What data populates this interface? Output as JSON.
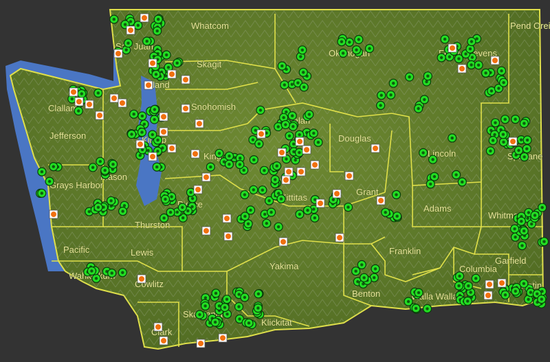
{
  "map": {
    "colors": {
      "background": "#333333",
      "water": "#4a76c4",
      "land": "#5f7d2a",
      "border": "#e0e04a",
      "marker_green": "#22dd22",
      "marker_orange": "#f07010"
    },
    "county_labels": [
      "Whatcom",
      "Okanogan",
      "Ferry",
      "Stevens",
      "Pend Oreille",
      "Clallam",
      "Skagit",
      "Snohomish",
      "San Juan",
      "Island",
      "Jefferson",
      "Chelan",
      "Douglas",
      "Lincoln",
      "Spokane",
      "Mason",
      "Kitsap",
      "King",
      "Grays Harbor",
      "Kittitas",
      "Grant",
      "Pierce",
      "Thurston",
      "Adams",
      "Whitman",
      "Pacific",
      "Lewis",
      "Franklin",
      "Garfield",
      "Wahkiakum",
      "Cowlitz",
      "Skamania",
      "Yakima",
      "Benton",
      "Walla Walla",
      "Asotin",
      "Clark",
      "Klickitat",
      "Columbia"
    ]
  }
}
